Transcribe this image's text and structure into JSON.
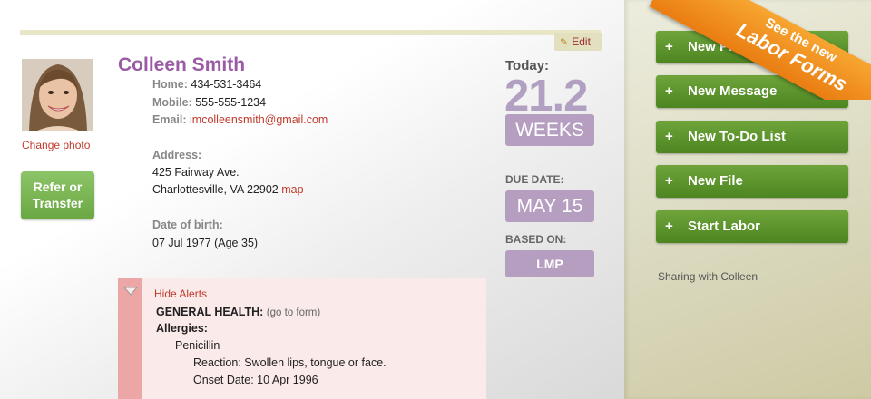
{
  "patient": {
    "name": "Colleen Smith",
    "change_photo": "Change photo",
    "refer_line1": "Refer or",
    "refer_line2": "Transfer",
    "edit": "Edit",
    "home_label": "Home:",
    "home": "434-531-3464",
    "mobile_label": "Mobile:",
    "mobile": "555-555-1234",
    "email_label": "Email:",
    "email": "imcolleensmith@gmail.com",
    "address_label": "Address:",
    "address_line1": "425 Fairway Ave.",
    "address_line2": "Charlottesville, VA 22902",
    "map_link": "map",
    "dob_label": "Date of birth:",
    "dob": "07 Jul 1977 (Age 35)"
  },
  "pregnancy": {
    "today_label": "Today:",
    "weeks": "21.2",
    "weeks_unit": "WEEKS",
    "due_label": "DUE DATE:",
    "due_date": "MAY 15",
    "based_label": "BASED ON:",
    "based_on": "LMP"
  },
  "alerts": {
    "hide": "Hide Alerts",
    "section": "GENERAL HEALTH:",
    "go_to_form": "(go to form)",
    "allergies": "Allergies:",
    "allergen": "Penicillin",
    "reaction": "Reaction: Swollen lips, tongue or face.",
    "onset": "Onset Date: 10 Apr 1996"
  },
  "actions": [
    {
      "label": "New Pr"
    },
    {
      "label": "New Message"
    },
    {
      "label": "New To-Do List"
    },
    {
      "label": "New File"
    },
    {
      "label": "Start Labor"
    }
  ],
  "sharing": "Sharing with Colleen",
  "ribbon": {
    "line1": "See the new",
    "line2": "Labor Forms"
  },
  "colors": {
    "name": "#9a5aa4",
    "pill": "#b59ec0",
    "action_green": "#5a9530",
    "ribbon": "#f0911f",
    "alert_stripe": "#eda6a6"
  }
}
